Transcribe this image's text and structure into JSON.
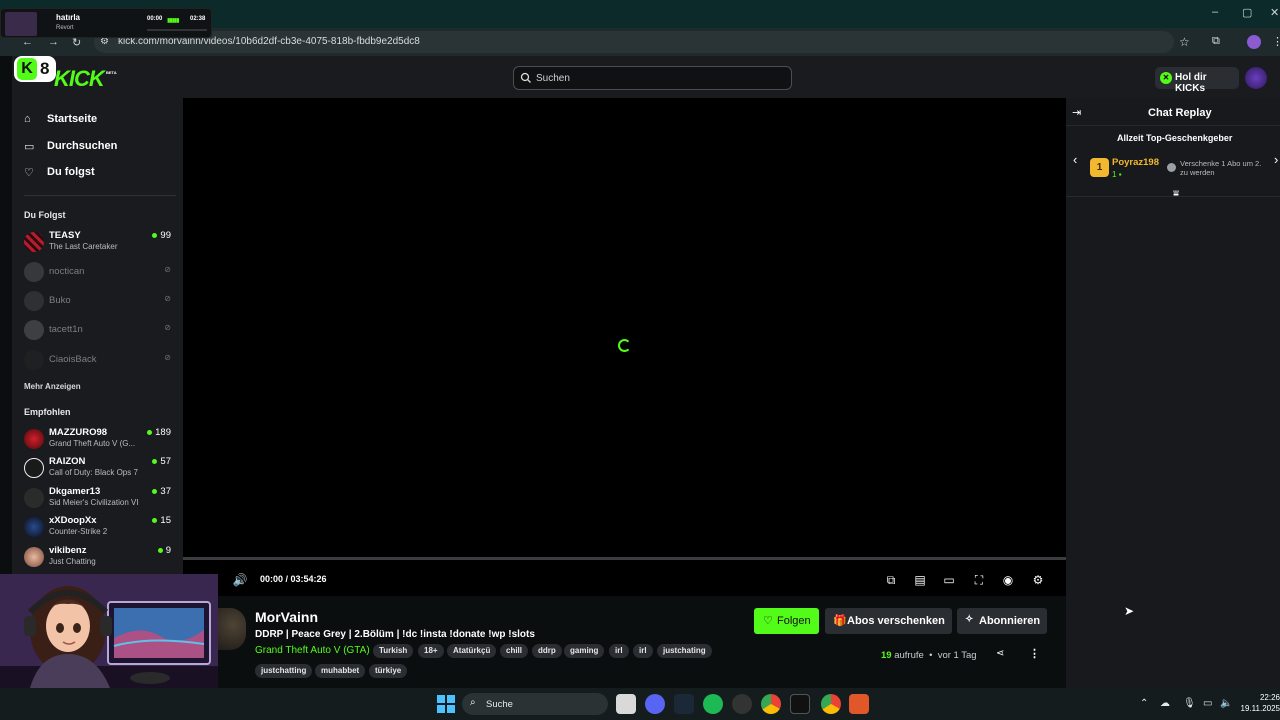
{
  "browser": {
    "url": "kick.com/morvainn/videos/10b6d2df-cb3e-4075-818b-fbdb9e2d5dc8",
    "window_controls": [
      "–",
      "▢",
      "✕"
    ]
  },
  "music_widget": {
    "title": "hatırla",
    "artist": "Revort",
    "elapsed": "00:00",
    "total": "02:38"
  },
  "overlay_badge": {
    "letter": "K",
    "number": "8"
  },
  "header": {
    "logo": "KICK",
    "beta": "BETA",
    "search_placeholder": "Suchen",
    "kicks_button": "Hol dir KICKs"
  },
  "sidebar": {
    "nav": [
      {
        "label": "Startseite",
        "icon": "home-icon"
      },
      {
        "label": "Durchsuchen",
        "icon": "browse-icon"
      },
      {
        "label": "Du folgst",
        "icon": "heart-icon"
      }
    ],
    "following_heading": "Du Folgst",
    "following": [
      {
        "name": "TEASY",
        "category": "The Last Caretaker",
        "viewers": "99",
        "live": true
      },
      {
        "name": "noctican",
        "live": false
      },
      {
        "name": "Buko",
        "live": false
      },
      {
        "name": "tacett1n",
        "live": false
      },
      {
        "name": "CiaoisBack",
        "live": false
      }
    ],
    "more_label": "Mehr Anzeigen",
    "recommended_heading": "Empfohlen",
    "recommended": [
      {
        "name": "MAZZURO98",
        "category": "Grand Theft Auto V (G...",
        "viewers": "189"
      },
      {
        "name": "RAIZON",
        "category": "Call of Duty: Black Ops 7",
        "viewers": "57"
      },
      {
        "name": "Dkgamer13",
        "category": "Sid Meier's Civilization VI",
        "viewers": "37"
      },
      {
        "name": "xXDoopXx",
        "category": "Counter-Strike 2",
        "viewers": "15"
      },
      {
        "name": "vikibenz",
        "category": "Just Chatting",
        "viewers": "9"
      }
    ]
  },
  "player": {
    "time": "00:00 / 03:54:26",
    "progress": 0
  },
  "chat": {
    "title": "Chat Replay",
    "top_gifter_heading": "Allzeit Top-Geschenkgeber",
    "gifter_rank": "1",
    "gifter_name": "Poyraz198",
    "gifter_count": "1",
    "gift_cta": "Verschenke 1 Abo um 2. zu werden"
  },
  "stream": {
    "streamer": "MorVainn",
    "title": "DDRP | Peace Grey | 2.Bölüm | !dc !insta !donate !wp !slots",
    "game": "Grand Theft Auto V (GTA)",
    "tags_row1": [
      "Turkish",
      "18+",
      "Atatürkçü",
      "chill",
      "ddrp",
      "gaming",
      "irl",
      "irl",
      "justchating"
    ],
    "tags_row2": [
      "justchatting",
      "muhabbet",
      "türkiye"
    ],
    "follow_label": "Folgen",
    "gift_label": "Abos verschenken",
    "subscribe_label": "Abonnieren",
    "views_count": "19",
    "views_label": "aufrufe",
    "age": "vor 1 Tag"
  },
  "taskbar": {
    "search_label": "Suche",
    "time": "22:26",
    "date": "19.11.2025"
  },
  "colors": {
    "kick_green": "#53fc18",
    "gold": "#f2b930",
    "panel": "#191b1f"
  }
}
